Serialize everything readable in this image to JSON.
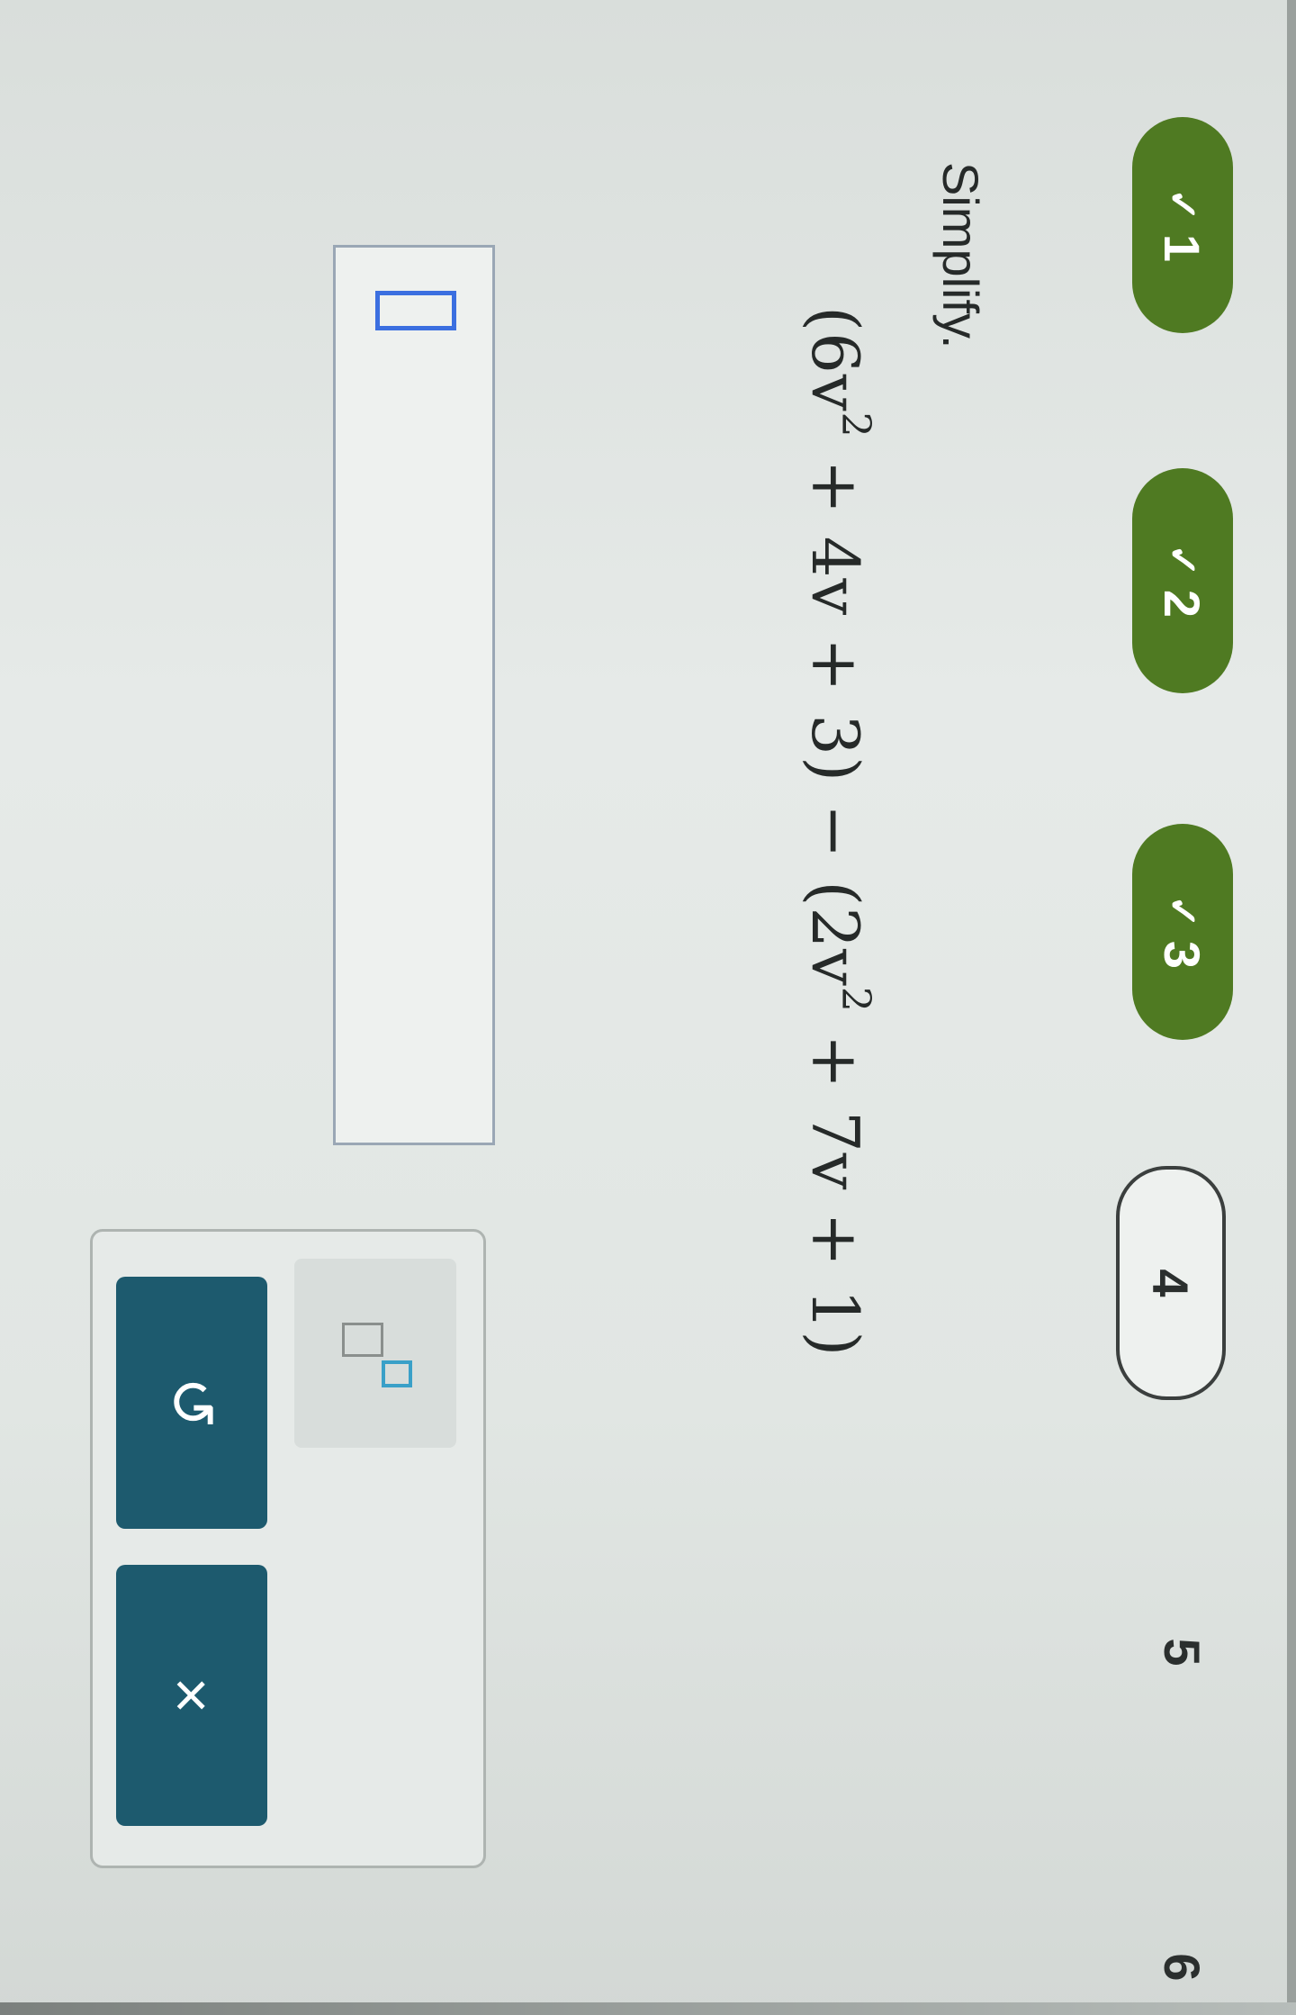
{
  "progress": {
    "steps": [
      {
        "label": "1",
        "status": "done"
      },
      {
        "label": "2",
        "status": "done"
      },
      {
        "label": "3",
        "status": "done"
      },
      {
        "label": "4",
        "status": "current"
      },
      {
        "label": "5",
        "status": "pending"
      },
      {
        "label": "6",
        "status": "pending"
      }
    ],
    "check_glyph": "✓"
  },
  "question": {
    "prompt": "Simplify.",
    "expression": {
      "open1": "(6v",
      "exp1": "2",
      "mid1": " + 4v + 3) − (2v",
      "exp2": "2",
      "mid2": " + 7v + 1)"
    }
  },
  "answer": {
    "value": ""
  },
  "tools": {
    "exponent_icon": "exponent-template-icon",
    "undo_glyph": "↺",
    "clear_glyph": "×"
  },
  "colors": {
    "done": "#4f7a22",
    "button": "#1d5a6e",
    "cursor": "#3b6fe0"
  }
}
